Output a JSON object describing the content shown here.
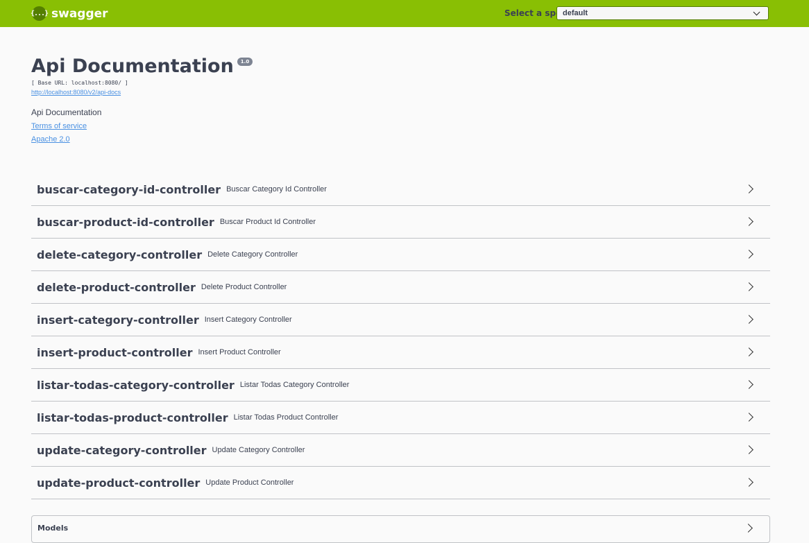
{
  "topbar": {
    "logo_glyph": "{...}",
    "logo_text": "swagger",
    "spec_label": "Select a spec",
    "spec_value": "default"
  },
  "info": {
    "title": "Api Documentation",
    "version": "1.0",
    "base_url": "[ Base URL: localhost:8080/ ]",
    "docs_link": "http://localhost:8080/v2/api-docs",
    "description": "Api Documentation",
    "terms_link": "Terms of service",
    "license_link": "Apache 2.0"
  },
  "controllers": [
    {
      "name": "buscar-category-id-controller",
      "description": "Buscar Category Id Controller"
    },
    {
      "name": "buscar-product-id-controller",
      "description": "Buscar Product Id Controller"
    },
    {
      "name": "delete-category-controller",
      "description": "Delete Category Controller"
    },
    {
      "name": "delete-product-controller",
      "description": "Delete Product Controller"
    },
    {
      "name": "insert-category-controller",
      "description": "Insert Category Controller"
    },
    {
      "name": "insert-product-controller",
      "description": "Insert Product Controller"
    },
    {
      "name": "listar-todas-category-controller",
      "description": "Listar Todas Category Controller"
    },
    {
      "name": "listar-todas-product-controller",
      "description": "Listar Todas Product Controller"
    },
    {
      "name": "update-category-controller",
      "description": "Update Category Controller"
    },
    {
      "name": "update-product-controller",
      "description": "Update Product Controller"
    }
  ],
  "models": {
    "label": "Models"
  },
  "colors": {
    "topbar": "#89bf04",
    "link": "#4990e2",
    "text": "#3b4151"
  }
}
